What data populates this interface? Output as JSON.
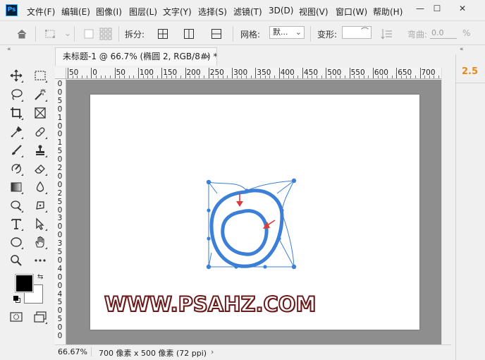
{
  "app": {
    "logo_text": "Ps"
  },
  "menu": {
    "items": [
      "文件(F)",
      "编辑(E)",
      "图像(I)",
      "图层(L)",
      "文字(Y)",
      "选择(S)",
      "滤镜(T)",
      "3D(D)",
      "视图(V)",
      "窗口(W)",
      "帮助(H)"
    ]
  },
  "window_controls": {
    "minimize": "—",
    "maximize": "☐",
    "close": "✕"
  },
  "options_bar": {
    "split_label": "拆分:",
    "grid_label": "网格:",
    "grid_value": "默...",
    "warp_label": "变形:",
    "warp_value": "",
    "bend_label": "弯曲:",
    "bend_value": "0.0",
    "bend_unit": "%"
  },
  "collapse": {
    "left": "«",
    "right": "«"
  },
  "document": {
    "tab_title": "未标题-1 @ 66.7% (椭圆 2, RGB/8#) *",
    "close": "×"
  },
  "ruler": {
    "top_labels": [
      "50",
      "0",
      "50",
      "100",
      "150",
      "200",
      "250",
      "300",
      "350",
      "400",
      "450",
      "500",
      "550",
      "600",
      "650",
      "700"
    ],
    "left_labels": [
      "0",
      "0",
      "5",
      "0",
      "1",
      "0",
      "0",
      "1",
      "5",
      "0",
      "2",
      "0",
      "0",
      "2",
      "5",
      "0",
      "3",
      "0",
      "0",
      "3",
      "5",
      "0",
      "4",
      "0",
      "0",
      "4",
      "5",
      "0",
      "5",
      "0",
      "0"
    ]
  },
  "canvas": {
    "watermark_text": "WWW.PSAHZ.COM",
    "path_color": "#3b7fd6",
    "arrow_color": "#e03a3a",
    "watermark_fill": "#ffffff",
    "watermark_stroke": "#6b1a1a"
  },
  "right_panel": {
    "value": "2.5"
  },
  "status": {
    "zoom": "66.67%",
    "doc_info": "700 像素 x 500 像素 (72 ppi)",
    "arrow": "›"
  },
  "colors": {
    "foreground": "#000000",
    "background": "#ffffff"
  }
}
